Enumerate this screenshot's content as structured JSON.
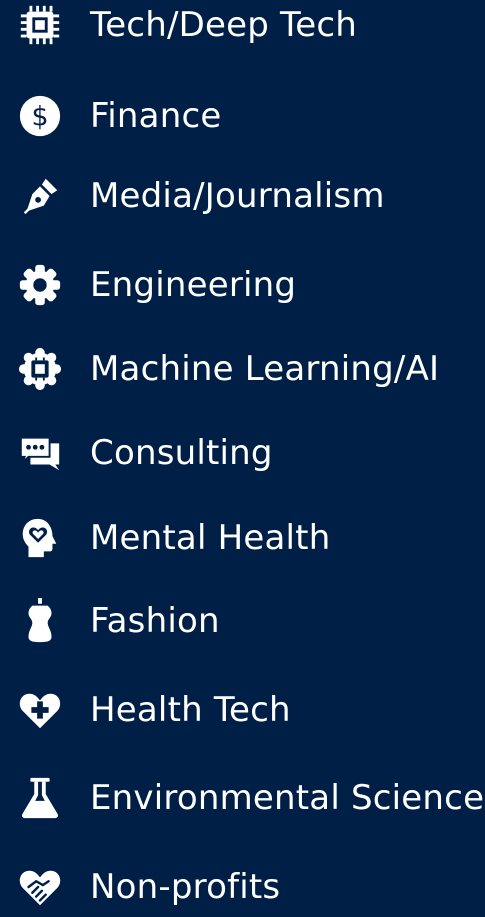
{
  "categories": [
    {
      "label": "Tech/Deep Tech",
      "icon": "microchip-icon"
    },
    {
      "label": "Finance",
      "icon": "dollar-circle-icon"
    },
    {
      "label": "Media/Journalism",
      "icon": "fountain-pen-icon"
    },
    {
      "label": "Engineering",
      "icon": "gear-icon"
    },
    {
      "label": "Machine Learning/AI",
      "icon": "chip-gear-icon"
    },
    {
      "label": "Consulting",
      "icon": "chat-bubbles-icon"
    },
    {
      "label": "Mental Health",
      "icon": "head-heart-icon"
    },
    {
      "label": "Fashion",
      "icon": "dress-form-icon"
    },
    {
      "label": "Health Tech",
      "icon": "heart-plus-icon"
    },
    {
      "label": "Environmental Science",
      "icon": "flask-icon"
    },
    {
      "label": "Non-profits",
      "icon": "handshake-heart-icon"
    }
  ],
  "colors": {
    "background": "#001f47",
    "foreground": "#ffffff"
  }
}
